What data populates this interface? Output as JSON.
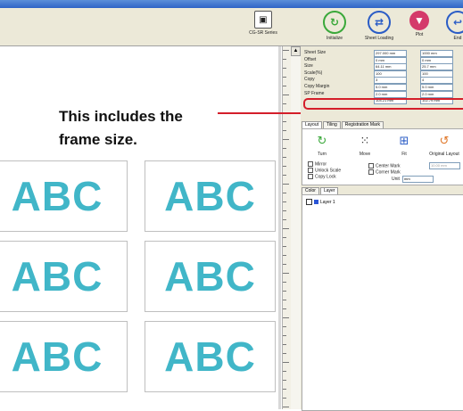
{
  "toolbar": {
    "buttons": [
      {
        "label": "CG-SR Series",
        "icon": "printer-icon"
      },
      {
        "label": "Initialize",
        "icon": "refresh-icon",
        "color": "#3aa83a"
      },
      {
        "label": "Sheet Loading",
        "icon": "swap-icon",
        "color": "#2a5cc6"
      },
      {
        "label": "Plot",
        "icon": "plot-icon",
        "color": "#d43a6a"
      },
      {
        "label": "End",
        "icon": "exit-icon",
        "color": "#2a5cc6"
      }
    ]
  },
  "properties": {
    "rows": [
      {
        "label": "Sheet Size",
        "v1": "297.000 mm",
        "v2": "1000 mm"
      },
      {
        "label": "Offset",
        "v1": "0 mm",
        "v2": "0 mm"
      },
      {
        "label": "Size",
        "v1": "64.11 mm",
        "v2": "25.7 mm"
      },
      {
        "label": "Scale(%)",
        "v1": "100",
        "v2": "100"
      },
      {
        "label": "Copy",
        "v1": "3",
        "v2": "4"
      },
      {
        "label": "Copy Margin",
        "v1": "5.0 mm",
        "v2": "5.0 mm"
      },
      {
        "label": "SP Frame",
        "v1": "2.0 mm",
        "v2": "2.0 mm"
      },
      {
        "label": "",
        "v1": "104.21 mm",
        "v2": "102.79 mm"
      }
    ]
  },
  "callout": "This includes the frame size.",
  "layout_tabs": [
    "Layout",
    "Tiling",
    "Registration Mark"
  ],
  "tools": [
    {
      "label": "Turn",
      "icon": "rotate-icon"
    },
    {
      "label": "Move",
      "icon": "move-icon"
    },
    {
      "label": "Fit",
      "icon": "fit-icon"
    },
    {
      "label": "Original Layout",
      "icon": "original-layout-icon"
    }
  ],
  "options": {
    "mirror": "Mirror",
    "unlock_scale": "Unlock Scale",
    "copy_lock": "Copy Lock",
    "center_mark": "Center Mark",
    "corner_mark": "Corner Mark",
    "unit_label": "Unit",
    "unit_value": "mm",
    "center_mark_field": "10.00 mm"
  },
  "panel_tabs": [
    "Color",
    "Layer"
  ],
  "layers": [
    {
      "name": "Layer 1",
      "color": "#2a55d6"
    }
  ],
  "labels": [
    "ABC",
    "ABC",
    "ABC",
    "ABC",
    "ABC",
    "ABC"
  ],
  "colors": {
    "abc_text": "#41b6c8",
    "highlight": "#d41e2a"
  }
}
